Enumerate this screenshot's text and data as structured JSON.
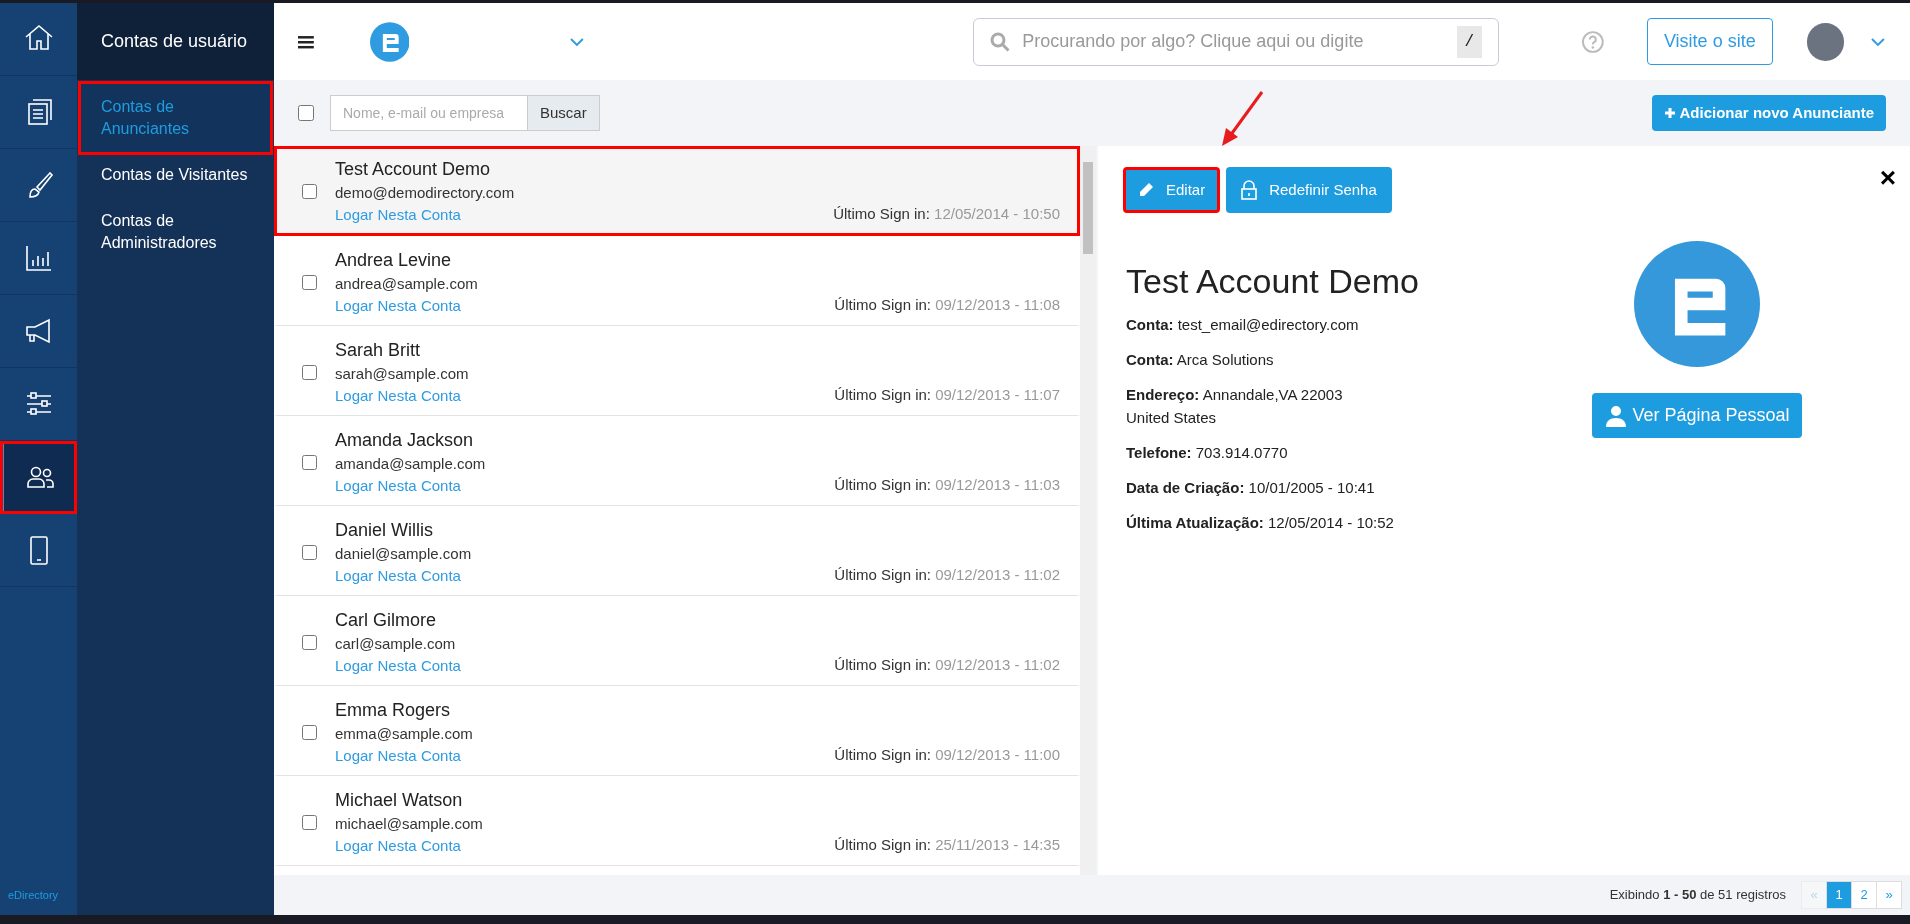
{
  "rail": [
    {
      "kind": "home",
      "selected": false,
      "highlighted": false
    },
    {
      "kind": "content",
      "selected": false,
      "highlighted": false
    },
    {
      "kind": "design",
      "selected": false,
      "highlighted": false
    },
    {
      "kind": "reports",
      "selected": false,
      "highlighted": false
    },
    {
      "kind": "promote",
      "selected": false,
      "highlighted": false
    },
    {
      "kind": "settings",
      "selected": false,
      "highlighted": false
    },
    {
      "kind": "users",
      "selected": true,
      "highlighted": true
    },
    {
      "kind": "mobile",
      "selected": false,
      "highlighted": false
    }
  ],
  "rail_footer": "eDirectory",
  "submenu": {
    "title": "Contas de usuário",
    "items": [
      {
        "label": "Contas de Anunciantes",
        "selected": true,
        "highlighted": true
      },
      {
        "label": "Contas de Visitantes",
        "selected": false,
        "highlighted": false
      },
      {
        "label": "Contas de Administradores",
        "selected": false,
        "highlighted": false
      }
    ]
  },
  "topbar": {
    "search_placeholder": "Procurando por algo? Clique aqui ou digite",
    "shortcut": "/",
    "visit_button": "Visite o site"
  },
  "toolbar": {
    "select_all_checked": false,
    "filter_placeholder": "Nome, e-mail ou empresa",
    "search_button": "Buscar",
    "add_button": "Adicionar novo Anunciante"
  },
  "accounts": [
    {
      "name": "Test Account Demo",
      "email": "demo@demodirectory.com",
      "login": "Logar Nesta Conta",
      "last_label": "Último Sign in:",
      "last": "12/05/2014 - 10:50",
      "highlighted": true
    },
    {
      "name": "Andrea Levine",
      "email": "andrea@sample.com",
      "login": "Logar Nesta Conta",
      "last_label": "Último Sign in:",
      "last": "09/12/2013 - 11:08",
      "highlighted": false
    },
    {
      "name": "Sarah Britt",
      "email": "sarah@sample.com",
      "login": "Logar Nesta Conta",
      "last_label": "Último Sign in:",
      "last": "09/12/2013 - 11:07",
      "highlighted": false
    },
    {
      "name": "Amanda Jackson",
      "email": "amanda@sample.com",
      "login": "Logar Nesta Conta",
      "last_label": "Último Sign in:",
      "last": "09/12/2013 - 11:03",
      "highlighted": false
    },
    {
      "name": "Daniel Willis",
      "email": "daniel@sample.com",
      "login": "Logar Nesta Conta",
      "last_label": "Último Sign in:",
      "last": "09/12/2013 - 11:02",
      "highlighted": false
    },
    {
      "name": "Carl Gilmore",
      "email": "carl@sample.com",
      "login": "Logar Nesta Conta",
      "last_label": "Último Sign in:",
      "last": "09/12/2013 - 11:02",
      "highlighted": false
    },
    {
      "name": "Emma Rogers",
      "email": "emma@sample.com",
      "login": "Logar Nesta Conta",
      "last_label": "Último Sign in:",
      "last": "09/12/2013 - 11:00",
      "highlighted": false
    },
    {
      "name": "Michael Watson",
      "email": "michael@sample.com",
      "login": "Logar Nesta Conta",
      "last_label": "Último Sign in:",
      "last": "25/11/2013 - 14:35",
      "highlighted": false
    }
  ],
  "detail": {
    "buttons": [
      {
        "kind": "edit",
        "label": "Editar",
        "highlighted": true
      },
      {
        "kind": "reset",
        "label": "Redefinir Senha",
        "highlighted": false
      }
    ],
    "close": "×",
    "title": "Test Account Demo",
    "fields": [
      {
        "label": "Conta:",
        "value": "test_email@edirectory.com"
      },
      {
        "label": "Conta:",
        "value": "Arca Solutions"
      },
      {
        "label": "Endereço:",
        "value": "Annandale,VA 22003",
        "value2": "United States"
      },
      {
        "label": "Telefone:",
        "value": "703.914.0770"
      },
      {
        "label": "Data de Criação:",
        "value": "10/01/2005 - 10:41"
      },
      {
        "label": "Última Atualização:",
        "value": "12/05/2014 - 10:52"
      }
    ],
    "profile_button": "Ver Página Pessoal"
  },
  "footer": {
    "summary": "Exibindo **1 - 50** de 51 registros",
    "pages": [
      {
        "label": "«",
        "selected": false,
        "disabled": true
      },
      {
        "label": "1",
        "selected": true,
        "disabled": false
      },
      {
        "label": "2",
        "selected": false,
        "disabled": false
      },
      {
        "label": "»",
        "selected": false,
        "disabled": false
      }
    ]
  }
}
